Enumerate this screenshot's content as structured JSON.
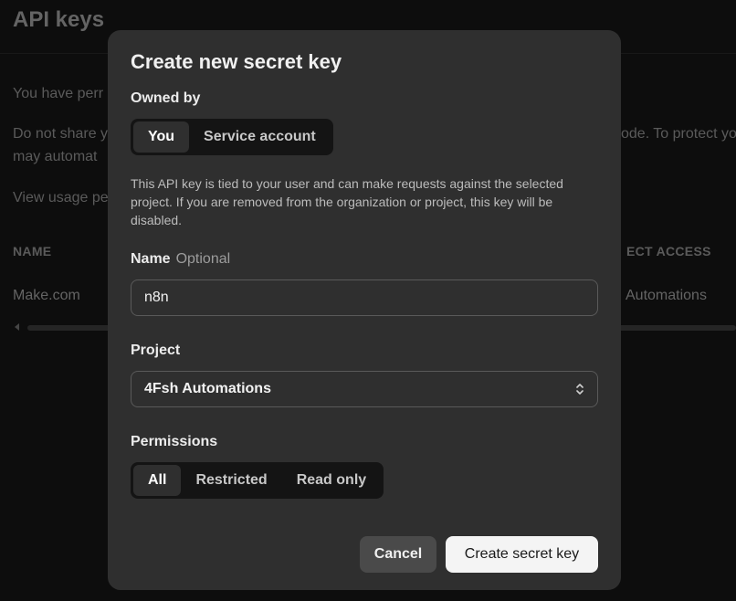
{
  "background": {
    "title": "API keys",
    "line1": "You have perr",
    "line2a": "Do not share y",
    "line2b": "ode. To protect yo",
    "line3": "may automat",
    "line4": "View usage pe",
    "col_name": "NAME",
    "col_access": "ECT ACCESS",
    "row_name": "Make.com",
    "row_access": "Automations"
  },
  "modal": {
    "title": "Create new secret key",
    "owned_by": {
      "label": "Owned by",
      "options": [
        "You",
        "Service account"
      ],
      "selected": "You"
    },
    "description": "This API key is tied to your user and can make requests against the selected project. If you are removed from the organization or project, this key will be disabled.",
    "name": {
      "label": "Name",
      "optional_hint": "Optional",
      "value": "n8n"
    },
    "project": {
      "label": "Project",
      "value": "4Fsh Automations"
    },
    "permissions": {
      "label": "Permissions",
      "options": [
        "All",
        "Restricted",
        "Read only"
      ],
      "selected": "All"
    },
    "cancel_label": "Cancel",
    "create_label": "Create secret key"
  },
  "icons": {
    "project_select": "chevron-up-down-icon",
    "scroll_left": "scroll-left-arrow-icon"
  },
  "colors": {
    "page_bg": "#141414",
    "modal_bg": "#2f2f2f",
    "segment_bg": "#141414",
    "primary_button_bg": "#f4f4f4",
    "secondary_button_bg": "#4a4a4a"
  }
}
